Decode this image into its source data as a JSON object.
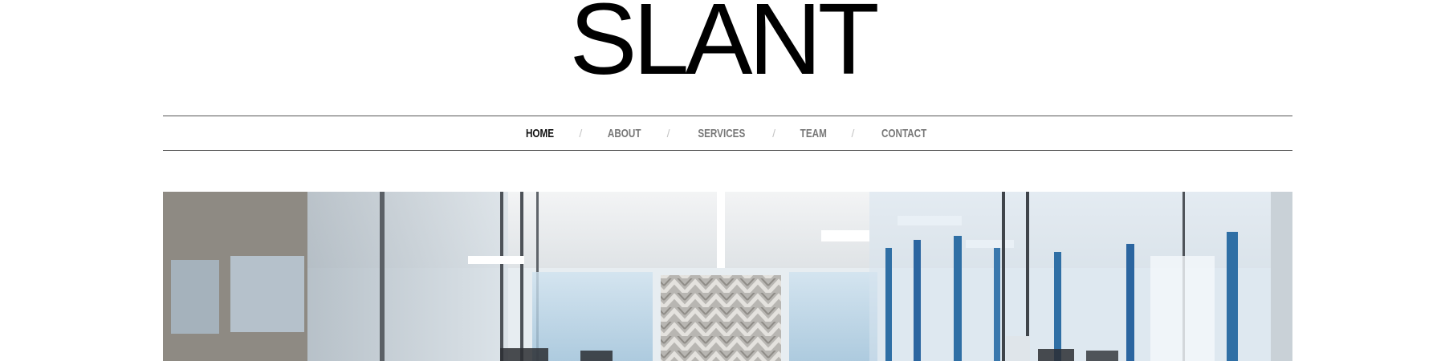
{
  "site": {
    "logo": "SLANT"
  },
  "nav": {
    "items": [
      {
        "label": "HOME",
        "active": true
      },
      {
        "label": "ABOUT",
        "active": false
      },
      {
        "label": "SERVICES",
        "active": false
      },
      {
        "label": "TEAM",
        "active": false
      },
      {
        "label": "CONTACT",
        "active": false
      }
    ],
    "separator": "/"
  },
  "hero": {
    "image": "office-interior-photo",
    "colors": {
      "glass": "#cfdbe6",
      "window_blue": "#2f6fa5",
      "ceiling": "#e9ecee",
      "wall_dark": "#8a8780"
    }
  }
}
